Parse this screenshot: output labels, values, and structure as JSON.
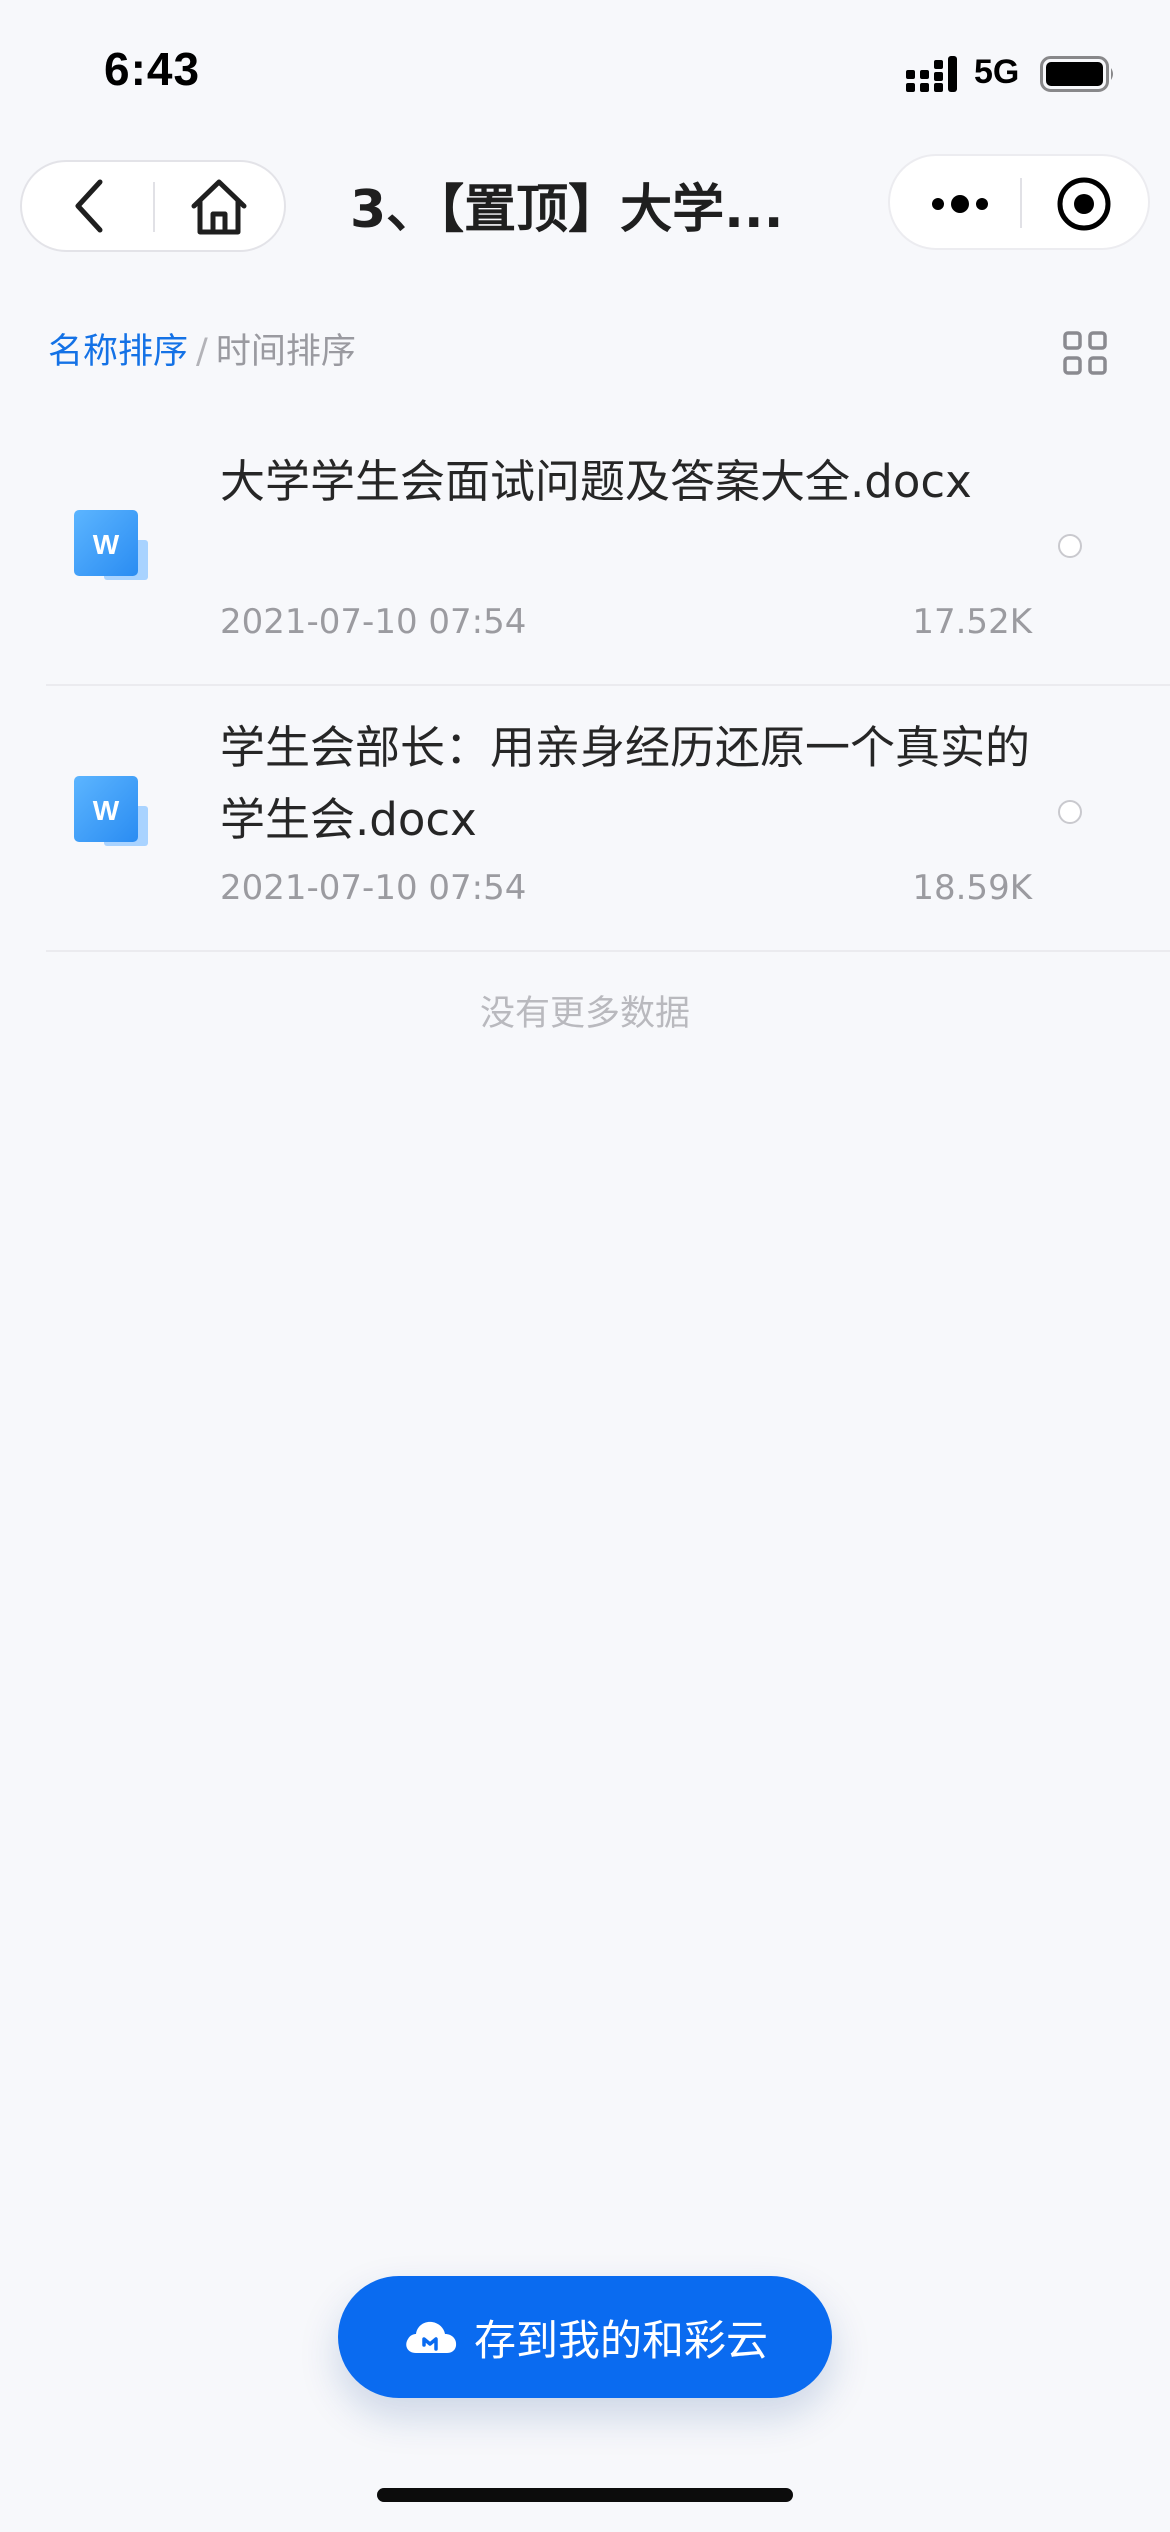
{
  "status_bar": {
    "time": "6:43",
    "network": "5G"
  },
  "nav": {
    "title": "3、【置顶】大学...",
    "back_icon": "chevron-left-icon",
    "home_icon": "home-icon",
    "more_icon": "more-dots-icon",
    "close_icon": "target-circle-icon"
  },
  "sort": {
    "by_name": "名称排序",
    "separator": "/",
    "by_time": "时间排序",
    "view_icon": "grid-view-icon"
  },
  "files": [
    {
      "name": "大学学生会面试问题及答案大全.docx",
      "date": "2021-07-10 07:54",
      "size": "17.52K",
      "icon": "word-doc-icon"
    },
    {
      "name": "学生会部长：用亲身经历还原一个真实的学生会.docx",
      "date": "2021-07-10 07:54",
      "size": "18.59K",
      "icon": "word-doc-icon"
    }
  ],
  "list_end_text": "没有更多数据",
  "save_button": {
    "label": "存到我的和彩云",
    "icon": "cloud-icon"
  },
  "colors": {
    "accent": "#0a6bf0",
    "sort_active": "#1472e6",
    "background": "#f7f8fb"
  }
}
